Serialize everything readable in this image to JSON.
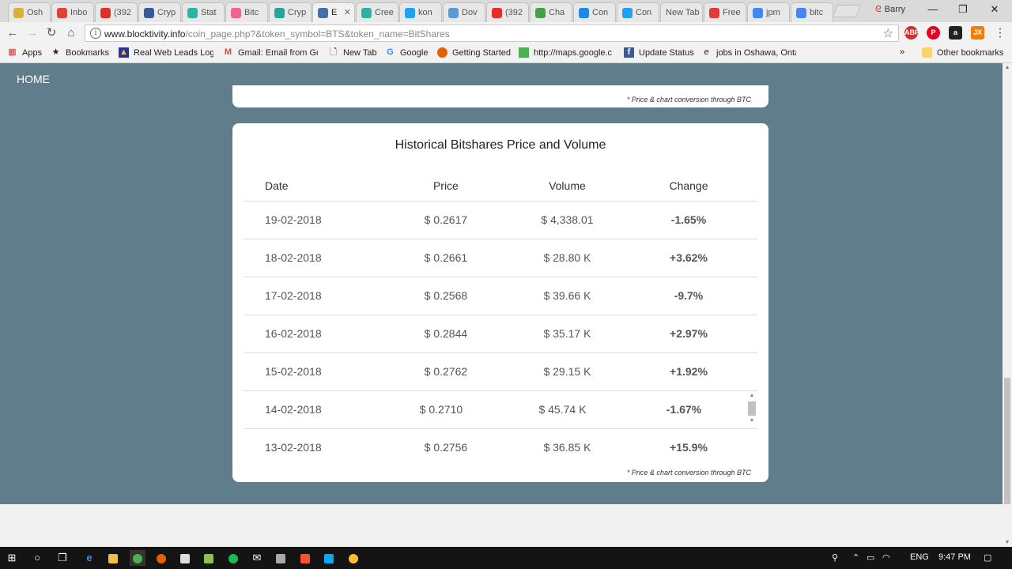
{
  "browser": {
    "tabs": [
      {
        "label": "Osh",
        "color": "#d9b13b"
      },
      {
        "label": "Inbo",
        "color": "#db4437"
      },
      {
        "label": "(392",
        "color": "#e52d27"
      },
      {
        "label": "Cryp",
        "color": "#3b5998"
      },
      {
        "label": "Stat",
        "color": "#2bb3a3"
      },
      {
        "label": "Bitc",
        "color": "#f06292"
      },
      {
        "label": "Cryp",
        "color": "#26a69a"
      },
      {
        "label": "E",
        "color": "#4a6fa5"
      },
      {
        "label": "Cree",
        "color": "#2bb3a3"
      },
      {
        "label": "kon",
        "color": "#1da1f2"
      },
      {
        "label": "Dov",
        "color": "#5b9bd5"
      },
      {
        "label": "(392",
        "color": "#e52d27"
      },
      {
        "label": "Cha",
        "color": "#43a047"
      },
      {
        "label": "Con",
        "color": "#1e88e5"
      },
      {
        "label": "Con",
        "color": "#1da1f2"
      },
      {
        "label": "New Tab",
        "color": ""
      },
      {
        "label": "Free",
        "color": "#e53935"
      },
      {
        "label": "jpm",
        "color": "#4285f4"
      },
      {
        "label": "bitc",
        "color": "#4285f4"
      }
    ],
    "active_tab_index": 7,
    "profile_name": "Barry",
    "url_domain": "www.blocktivity.info",
    "url_path": "/coin_page.php?&token_symbol=BTS&token_name=BitShares",
    "bookmarks": [
      {
        "label": "Apps",
        "icon": "apps-grid-icon"
      },
      {
        "label": "Bookmarks",
        "icon": "star-icon"
      },
      {
        "label": "Real Web Leads Logi",
        "icon": "leads-icon"
      },
      {
        "label": "Gmail: Email from Go",
        "icon": "gmail-icon"
      },
      {
        "label": "New Tab",
        "icon": "page-icon"
      },
      {
        "label": "Google",
        "icon": "google-icon"
      },
      {
        "label": "Getting Started",
        "icon": "firefox-icon"
      },
      {
        "label": "http://maps.google.c",
        "icon": "maps-icon"
      },
      {
        "label": "Update Status",
        "icon": "facebook-icon"
      },
      {
        "label": "jobs in Oshawa, Onta",
        "icon": "e-icon"
      }
    ],
    "more_bookmarks": "»",
    "other_bookmarks": "Other bookmarks"
  },
  "page": {
    "nav_home": "HOME",
    "top_card_footnote": "* Price & chart conversion through BTC",
    "card_title": "Historical Bitshares Price and Volume",
    "columns": [
      "Date",
      "Price",
      "Volume",
      "Change"
    ],
    "rows": [
      {
        "date": "19-02-2018",
        "price": "$ 0.2617",
        "volume": "$ 4,338.01",
        "change": "-1.65%",
        "dir": "neg"
      },
      {
        "date": "18-02-2018",
        "price": "$ 0.2661",
        "volume": "$ 28.80 K",
        "change": "+3.62%",
        "dir": "pos"
      },
      {
        "date": "17-02-2018",
        "price": "$ 0.2568",
        "volume": "$ 39.66 K",
        "change": "-9.7%",
        "dir": "neg"
      },
      {
        "date": "16-02-2018",
        "price": "$ 0.2844",
        "volume": "$ 35.17 K",
        "change": "+2.97%",
        "dir": "pos"
      },
      {
        "date": "15-02-2018",
        "price": "$ 0.2762",
        "volume": "$ 29.15 K",
        "change": "+1.92%",
        "dir": "pos"
      },
      {
        "date": "14-02-2018",
        "price": "$ 0.2710",
        "volume": "$ 45.74 K",
        "change": "-1.67%",
        "dir": "neg"
      },
      {
        "date": "13-02-2018",
        "price": "$ 0.2756",
        "volume": "$ 36.85 K",
        "change": "+15.9%",
        "dir": "pos"
      }
    ],
    "card_footnote": "* Price & chart conversion through BTC",
    "colors": {
      "background": "#607d8b",
      "negative": "#c0435d",
      "positive": "#1faa3c"
    }
  },
  "taskbar": {
    "language": "ENG",
    "time": "9:47 PM"
  }
}
